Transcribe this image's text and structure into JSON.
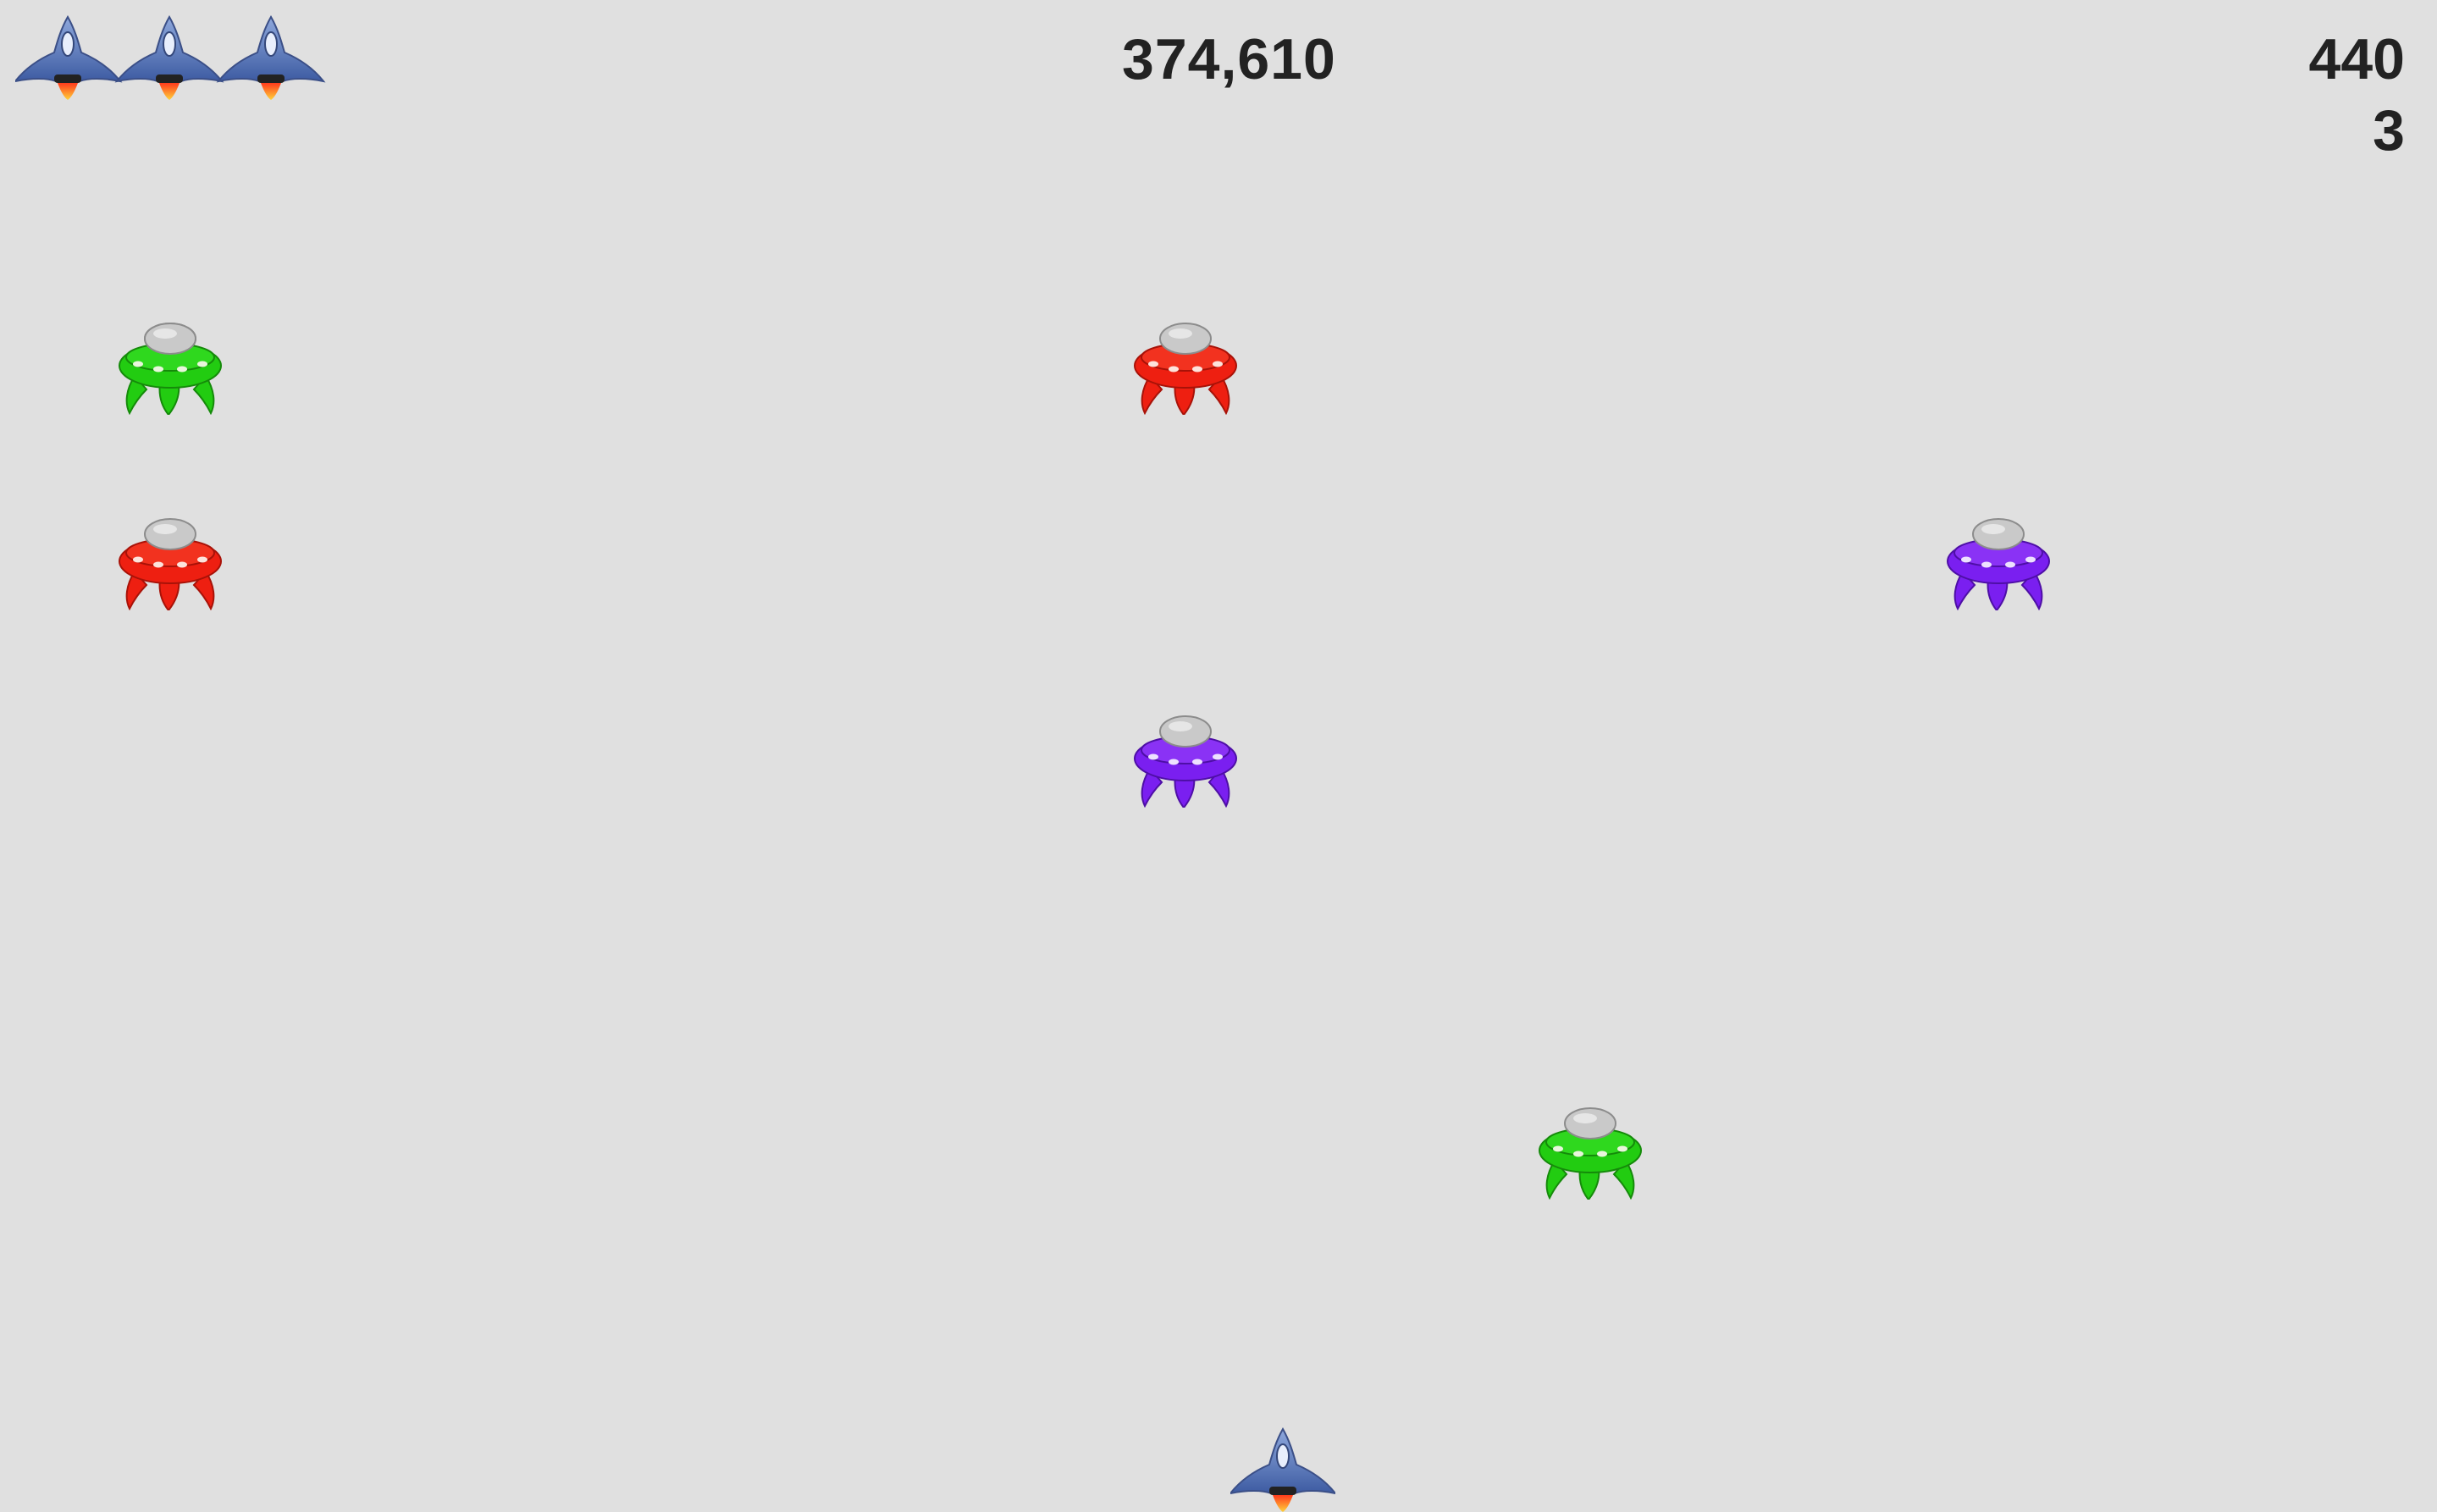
{
  "hud": {
    "score": "374,610",
    "right_top": "440",
    "right_bottom": "3",
    "lives_count": 3
  },
  "enemies": [
    {
      "color": "green",
      "hex": "#22cc11"
    },
    {
      "color": "red",
      "hex": "#ee1f11"
    },
    {
      "color": "red",
      "hex": "#ee1f11"
    },
    {
      "color": "purple",
      "hex": "#7a1ff0"
    },
    {
      "color": "purple",
      "hex": "#7a1ff0"
    },
    {
      "color": "green",
      "hex": "#22cc11"
    }
  ],
  "player": {
    "icon": "player-ship-icon"
  },
  "colors": {
    "background": "#e0e0e0",
    "ship_body": "#5f79b8",
    "flame": "#f05a1a"
  }
}
